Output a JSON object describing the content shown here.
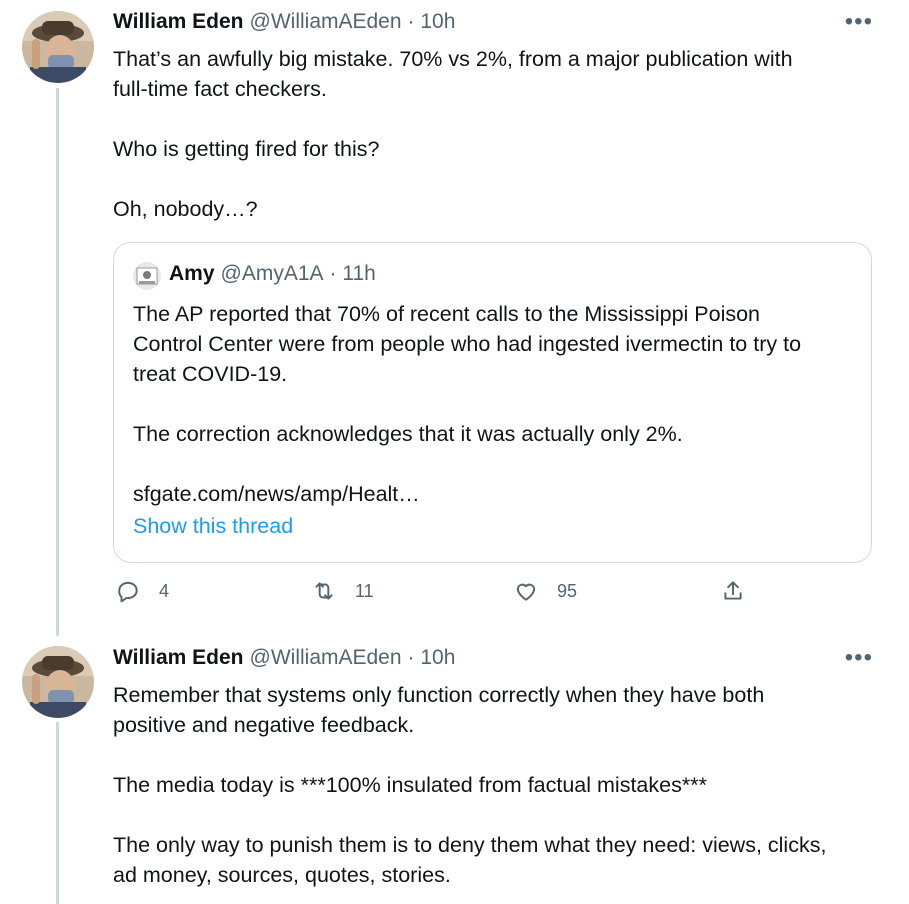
{
  "tweets": [
    {
      "name": "William Eden",
      "handle": "@WilliamAEden",
      "time": "· 10h",
      "more": "•••",
      "text": "That’s an awfully big mistake. 70% vs 2%, from a major publication with\nfull-time fact checkers.\n\nWho is getting fired for this?\n\nOh, nobody…?",
      "quote": {
        "name": "Amy",
        "handle": "@AmyA1A",
        "time": "· 11h",
        "text": "The AP reported that 70% of recent calls to the Mississippi Poison\nControl Center were from people who had ingested ivermectin to try to\ntreat COVID-19.\n\nThe correction acknowledges that it was actually only 2%.\n\nsfgate.com/news/amp/Healt…",
        "show_thread": "Show this thread"
      },
      "actions": {
        "reply_count": "4",
        "retweet_count": "11",
        "like_count": "95"
      }
    },
    {
      "name": "William Eden",
      "handle": "@WilliamAEden",
      "time": "· 10h",
      "more": "•••",
      "text": "Remember that systems only function correctly when they have both\npositive and negative feedback.\n\nThe media today is ***100% insulated from factual mistakes***\n\nThe only way to punish them is to deny them what they need: views, clicks,\nad money, sources, quotes, stories."
    }
  ],
  "colors": {
    "text": "#0f1419",
    "secondary": "#536471",
    "link": "#1d9bf0",
    "border": "#cfd9de"
  },
  "icons": [
    "reply-icon",
    "retweet-icon",
    "like-icon",
    "share-icon",
    "more-icon"
  ]
}
